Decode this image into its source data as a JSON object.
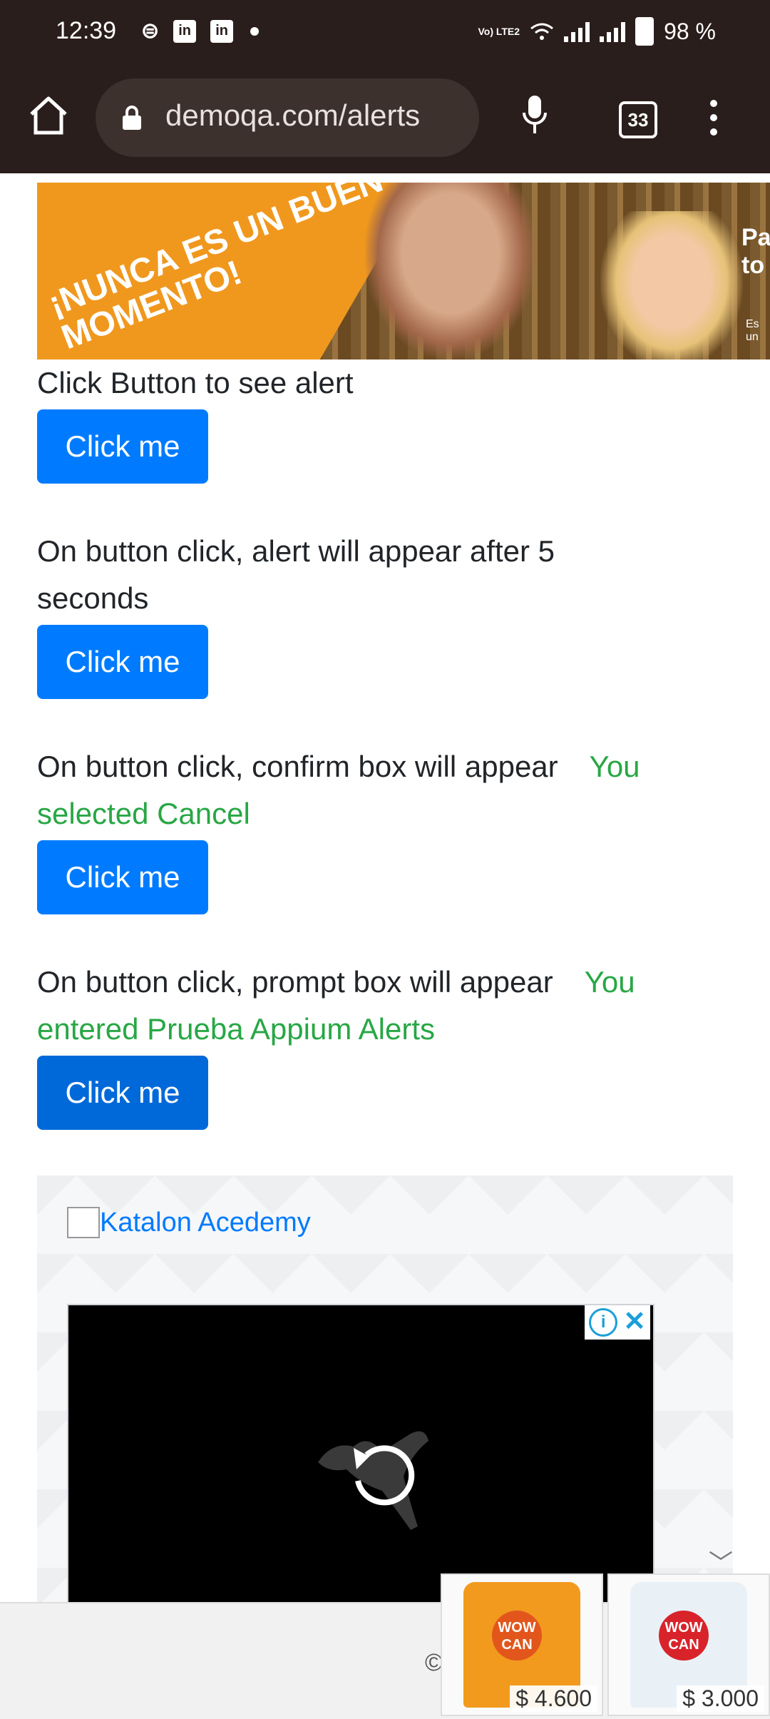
{
  "status_bar": {
    "time": "12:39",
    "left_icons": [
      "sim-icon",
      "linkedin-icon",
      "linkedin-icon",
      "dot-icon"
    ],
    "network": "Vo) LTE2",
    "battery": "98 %"
  },
  "browser": {
    "url": "demoqa.com/alerts",
    "tab_count": "33"
  },
  "banner_ad": {
    "headline": "¡NUNCA ES UN BUEN MOMENTO!",
    "side_text": "Pa to",
    "small_text": "Es un"
  },
  "alerts": [
    {
      "description": "Click Button to see alert",
      "result": "",
      "button": "Click me"
    },
    {
      "description": "On button click, alert will appear after 5 seconds",
      "result": "",
      "button": "Click me"
    },
    {
      "description": "On button click, confirm box will appear",
      "result": "You selected Cancel",
      "button": "Click me"
    },
    {
      "description": "On button click, prompt box will appear",
      "result": "You entered Prueba Appium Alerts",
      "button": "Click me"
    }
  ],
  "promo": {
    "image_alt": "Katalon Acedemy"
  },
  "footer": {
    "copyright": "©"
  },
  "product_ads": [
    {
      "brand": "WOW CAN",
      "price": "$ 4.600"
    },
    {
      "brand": "WOW CAN",
      "price": "$ 3.000"
    }
  ],
  "colors": {
    "primary": "#007bff",
    "success": "#28a745",
    "chrome_bg": "#2a1e1c"
  }
}
